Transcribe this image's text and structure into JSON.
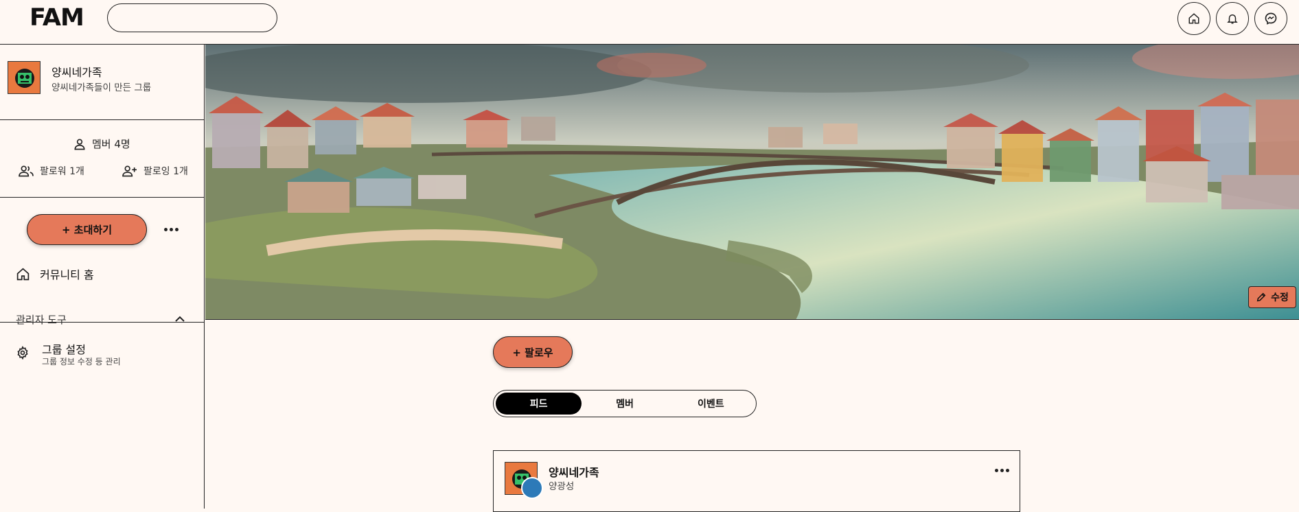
{
  "app": {
    "logo": "FAM"
  },
  "search": {
    "placeholder": ""
  },
  "group": {
    "name": "양씨네가족",
    "description": "양씨네가족들이 만든 그룹"
  },
  "stats": {
    "members": "멤버 4명",
    "followers": "팔로워 1개",
    "following": "팔로잉 1개"
  },
  "sidebar": {
    "invite_label": "+ 초대하기",
    "community_home": "커뮤니티 홈",
    "admin_tools": "관리자 도구",
    "group_settings": "그룹 설정",
    "group_settings_desc": "그룹 정보 수정 등 관리"
  },
  "banner": {
    "edit_label": "수정"
  },
  "main": {
    "follow_label": "+ 팔로우",
    "tabs": [
      {
        "label": "피드",
        "active": true
      },
      {
        "label": "멤버",
        "active": false
      },
      {
        "label": "이벤트",
        "active": false
      }
    ]
  },
  "post": {
    "group_name": "양씨네가족",
    "author": "양광성"
  },
  "colors": {
    "background": "#fff8f3",
    "accent": "#e5795a",
    "border": "#222222"
  }
}
